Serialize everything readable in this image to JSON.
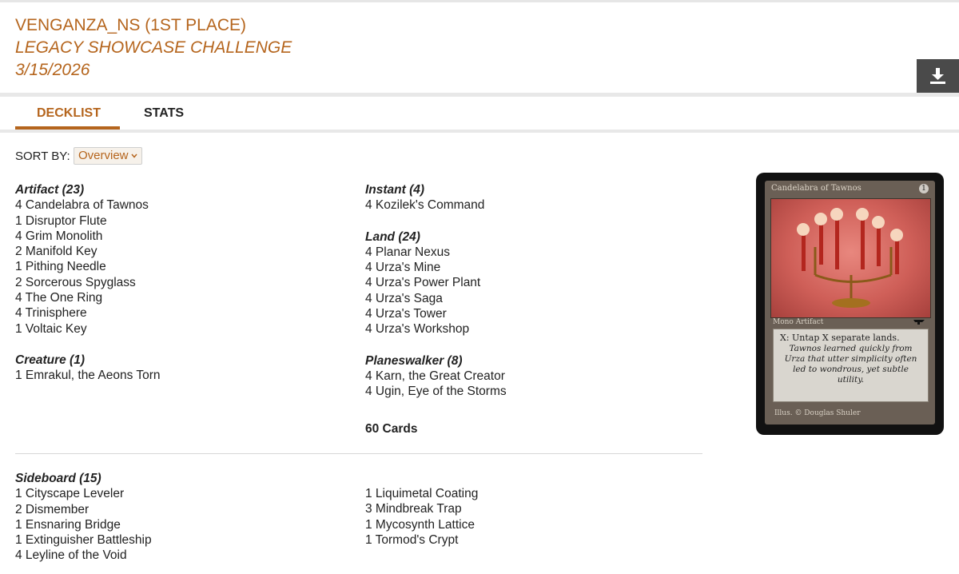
{
  "header": {
    "player": "VENGANZA_NS (1ST PLACE)",
    "event": "LEGACY SHOWCASE CHALLENGE",
    "date": "3/15/2026",
    "download_icon": "download-icon"
  },
  "tabs": [
    {
      "label": "DECKLIST",
      "active": true
    },
    {
      "label": "STATS",
      "active": false
    }
  ],
  "sort": {
    "label": "SORT BY:",
    "selected": "Overview"
  },
  "main_deck": {
    "column_left": [
      {
        "heading": "Artifact (23)",
        "cards": [
          "4 Candelabra of Tawnos",
          "1 Disruptor Flute",
          "4 Grim Monolith",
          "2 Manifold Key",
          "1 Pithing Needle",
          "2 Sorcerous Spyglass",
          "4 The One Ring",
          "4 Trinisphere",
          "1 Voltaic Key"
        ]
      },
      {
        "heading": "Creature (1)",
        "cards": [
          "1 Emrakul, the Aeons Torn"
        ]
      }
    ],
    "column_right": [
      {
        "heading": "Instant (4)",
        "cards": [
          "4 Kozilek's Command"
        ]
      },
      {
        "heading": "Land (24)",
        "cards": [
          "4 Planar Nexus",
          "4 Urza's Mine",
          "4 Urza's Power Plant",
          "4 Urza's Saga",
          "4 Urza's Tower",
          "4 Urza's Workshop"
        ]
      },
      {
        "heading": "Planeswalker (8)",
        "cards": [
          "4 Karn, the Great Creator",
          "4 Ugin, Eye of the Storms"
        ]
      }
    ],
    "total": "60 Cards"
  },
  "sideboard": {
    "heading": "Sideboard (15)",
    "column_left": [
      "1 Cityscape Leveler",
      "2 Dismember",
      "1 Ensnaring Bridge",
      "1 Extinguisher Battleship",
      "4 Leyline of the Void"
    ],
    "column_right": [
      "1 Liquimetal Coating",
      "3 Mindbreak Trap",
      "1 Mycosynth Lattice",
      "1 Tormod's Crypt"
    ]
  },
  "card_preview": {
    "name": "Candelabra of Tawnos",
    "cost": "1",
    "type_line": "Mono Artifact",
    "rules_text": "X: Untap X separate lands.",
    "flavor_text": "Tawnos learned quickly from Urza that utter simplicity often led to wondrous, yet subtle utility.",
    "illustrator": "Illus. © Douglas Shuler"
  },
  "colors": {
    "accent": "#b5651d",
    "download_button": "#4a4a4a",
    "separator": "#e8e8e8"
  }
}
